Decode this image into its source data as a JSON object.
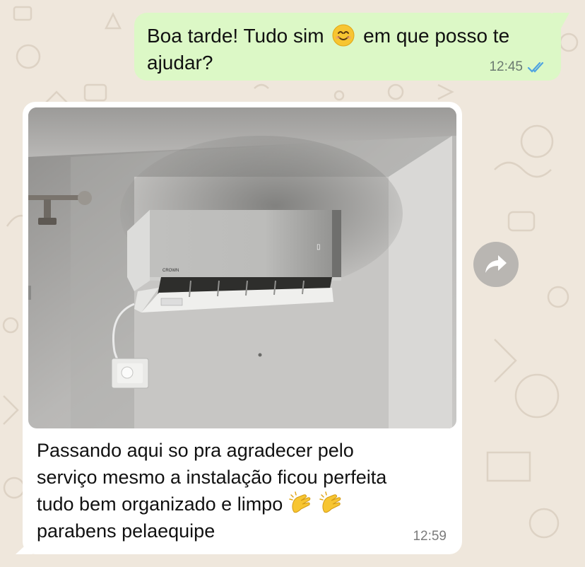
{
  "chat": {
    "outgoing": {
      "text_part1": "Boa tarde! Tudo sim",
      "emoji": "smiling-face-emoji",
      "text_part2": "em que posso te ajudar?",
      "time": "12:45",
      "status_icon": "double-check-read-icon",
      "status_color": "#4fa3e0"
    },
    "incoming": {
      "image": "photo-air-conditioner-on-wall",
      "text_line1": "Passando aqui so pra agradecer pelo",
      "text_line2": "serviço mesmo a instalação ficou perfeita",
      "text_line3": "tudo bem organizado e limpo",
      "emoji": "clapping-hands-emoji",
      "text_line4": "parabens pelaequipe",
      "time": "12:59"
    },
    "forward_button": {
      "icon": "forward-arrow-icon"
    }
  },
  "colors": {
    "background": "#efe7dc",
    "outgoing_bubble": "#dcf8c6",
    "incoming_bubble": "#ffffff"
  }
}
